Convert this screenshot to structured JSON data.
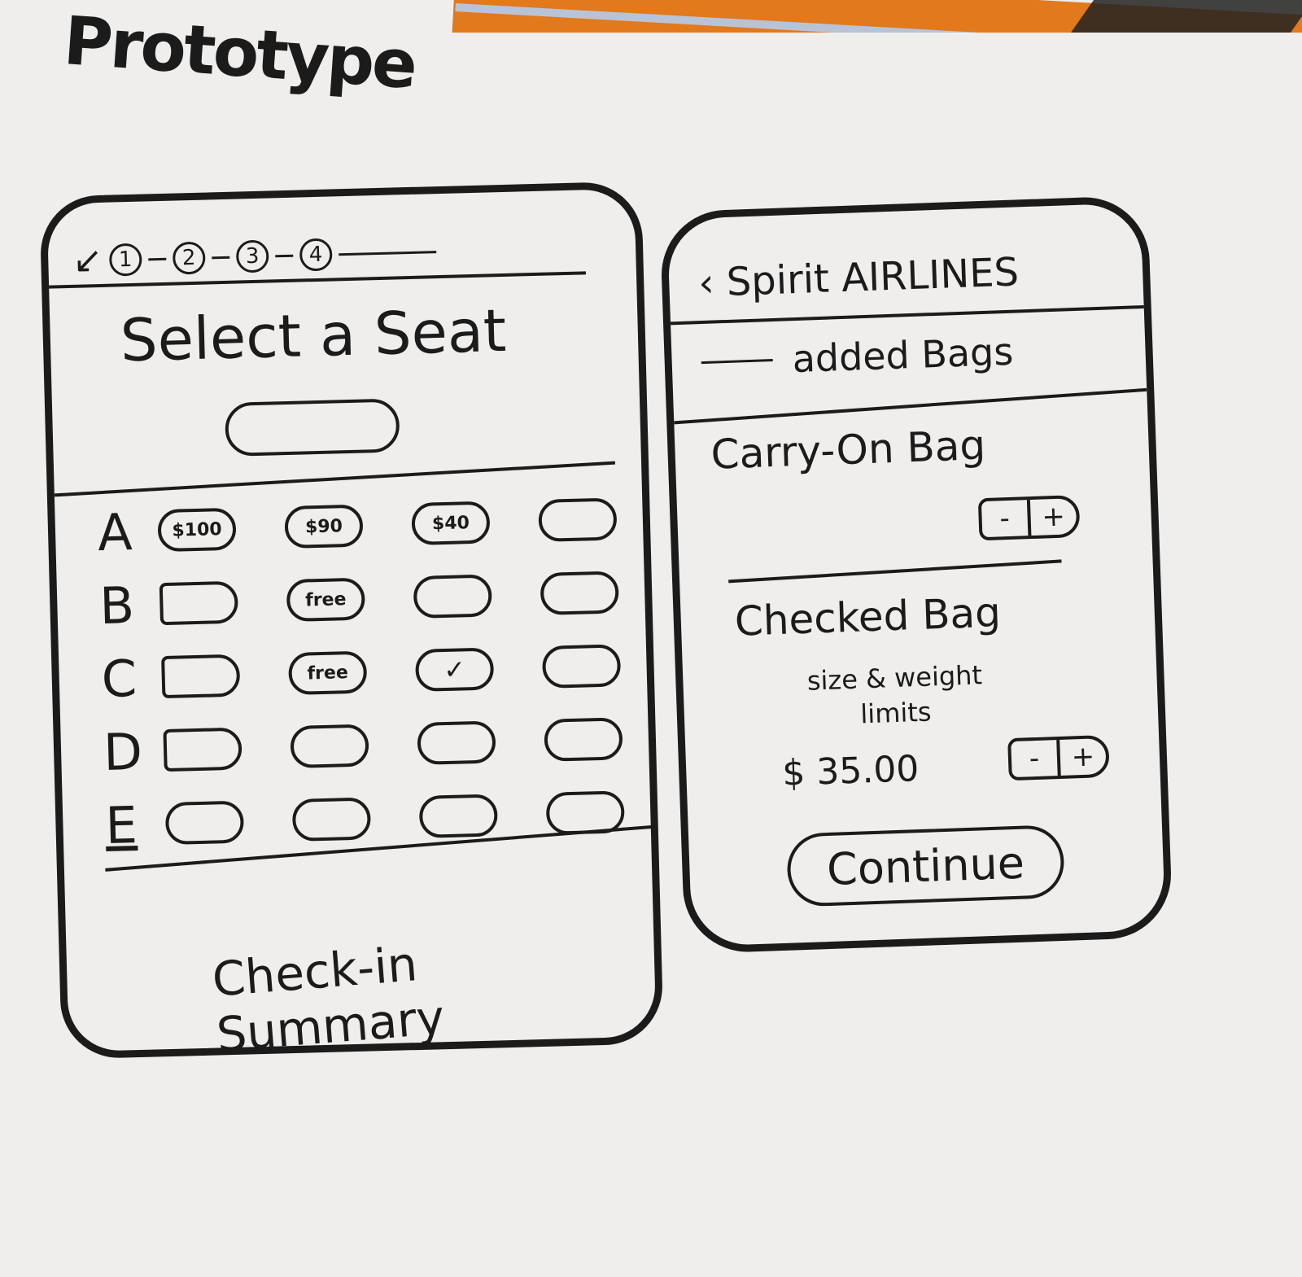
{
  "page": {
    "title": "Prototype"
  },
  "seat_screen": {
    "steps": [
      "1",
      "2",
      "3",
      "4"
    ],
    "title": "Select a Seat",
    "rows": [
      {
        "label": "A",
        "seats": [
          "$100",
          "$90",
          "$40",
          ""
        ]
      },
      {
        "label": "B",
        "seats": [
          "",
          "free",
          "",
          ""
        ]
      },
      {
        "label": "C",
        "seats": [
          "",
          "free",
          "✓",
          ""
        ]
      },
      {
        "label": "D",
        "seats": [
          "",
          "",
          "",
          ""
        ]
      },
      {
        "label": "E",
        "seats": [
          "",
          "",
          "",
          ""
        ]
      }
    ],
    "summary_label": "Check-in Summary"
  },
  "bags_screen": {
    "airline": "Spirit AIRLINES",
    "subtitle": "added Bags",
    "carry_on": {
      "title": "Carry-On Bag",
      "minus": "-",
      "plus": "+"
    },
    "checked": {
      "title": "Checked Bag",
      "note_line1": "size & weight",
      "note_line2": "limits",
      "price": "$ 35.00",
      "minus": "-",
      "plus": "+"
    },
    "continue_label": "Continue"
  },
  "icons": {
    "back": "back-arrow-icon",
    "check": "checkmark-icon"
  }
}
